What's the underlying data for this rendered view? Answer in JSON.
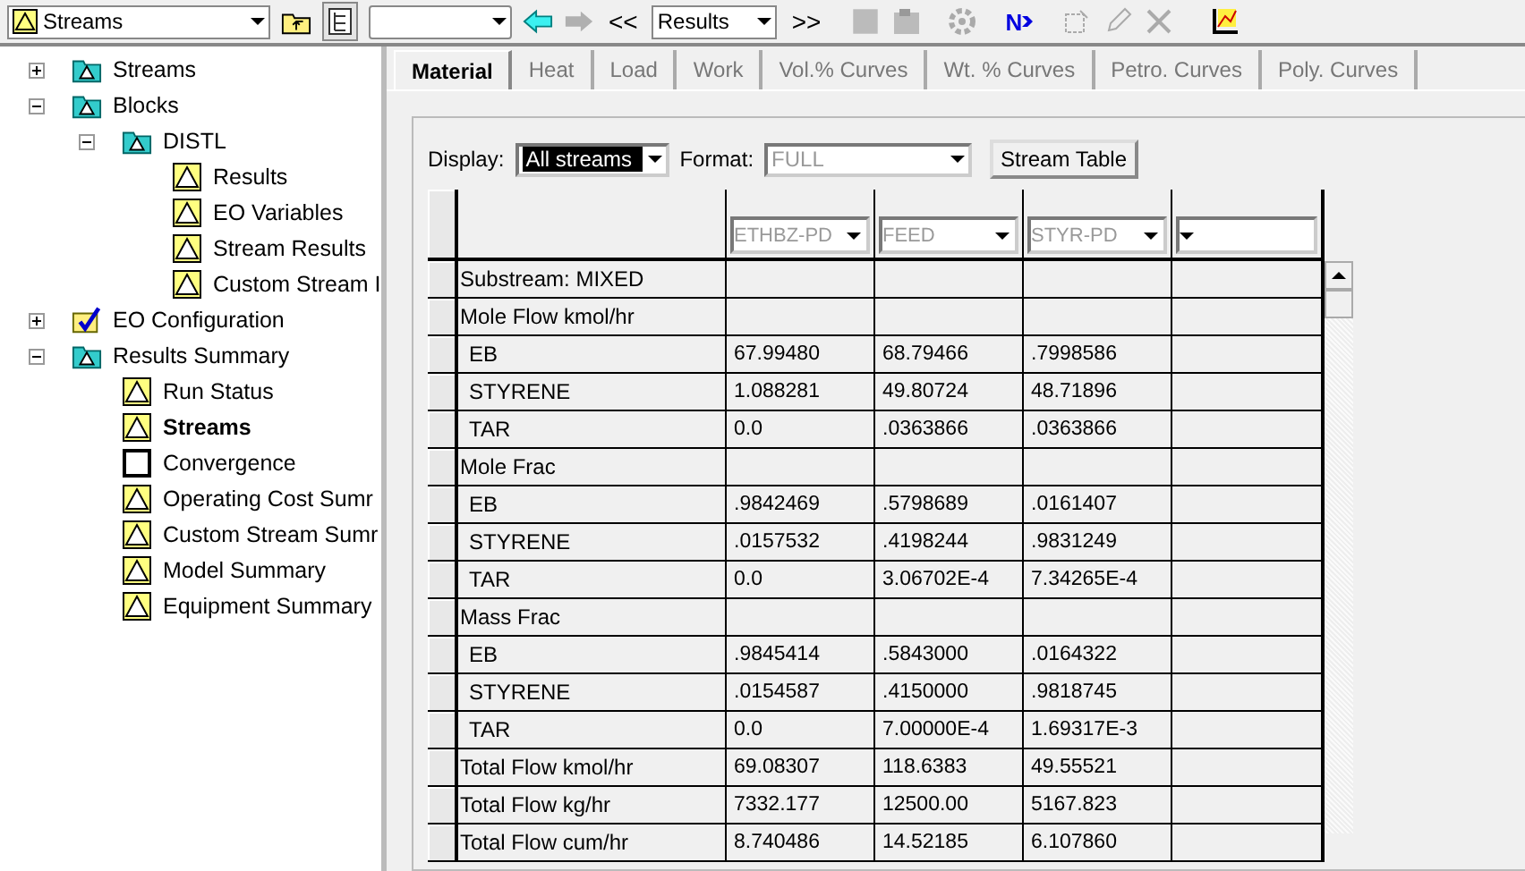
{
  "toolbar": {
    "object_combo": "Streams",
    "back_enabled": true,
    "forward_enabled": false,
    "prev_label": "<<",
    "results_combo": "Results",
    "next_label": ">>",
    "next_input_label": "N"
  },
  "tree": [
    {
      "label": "Streams",
      "kind": "folder",
      "expanded": false
    },
    {
      "label": "Blocks",
      "kind": "folder",
      "expanded": true,
      "children": [
        {
          "label": "DISTL",
          "kind": "folder",
          "expanded": true,
          "children": [
            {
              "label": "Results",
              "kind": "result"
            },
            {
              "label": "EO Variables",
              "kind": "result"
            },
            {
              "label": "Stream Results",
              "kind": "result"
            },
            {
              "label": "Custom Stream I",
              "kind": "result"
            }
          ]
        }
      ]
    },
    {
      "label": "EO Configuration",
      "kind": "configuration",
      "expanded": false
    },
    {
      "label": "Results Summary",
      "kind": "folder",
      "expanded": true,
      "children": [
        {
          "label": "Run Status",
          "kind": "result",
          "selected": false
        },
        {
          "label": "Streams",
          "kind": "result",
          "selected": true
        },
        {
          "label": "Convergence",
          "kind": "unavailable",
          "selected": false
        },
        {
          "label": "Operating Cost Sumr",
          "kind": "result",
          "selected": false
        },
        {
          "label": "Custom Stream Sumr",
          "kind": "result",
          "selected": false
        },
        {
          "label": "Model Summary",
          "kind": "result",
          "selected": false
        },
        {
          "label": "Equipment Summary",
          "kind": "result",
          "selected": false
        }
      ]
    }
  ],
  "tabs": [
    {
      "label": "Material",
      "selected": true
    },
    {
      "label": "Heat",
      "selected": false
    },
    {
      "label": "Load",
      "selected": false
    },
    {
      "label": "Work",
      "selected": false
    },
    {
      "label": "Vol.% Curves",
      "selected": false
    },
    {
      "label": "Wt. % Curves",
      "selected": false
    },
    {
      "label": "Petro. Curves",
      "selected": false
    },
    {
      "label": "Poly. Curves",
      "selected": false
    }
  ],
  "display": {
    "label": "Display:",
    "value": "All streams"
  },
  "format": {
    "label": "Format:",
    "value": "FULL"
  },
  "stream_table_button": "Stream Table",
  "columns": [
    {
      "value": "ETHBZ-PD"
    },
    {
      "value": "FEED"
    },
    {
      "value": "STYR-PD"
    },
    {}
  ],
  "rows": [
    {
      "kind": "section",
      "label": "Substream: MIXED"
    },
    {
      "kind": "section",
      "label": "Mole Flow kmol/hr"
    },
    {
      "kind": "component",
      "label": "EB",
      "values": [
        "67.99480",
        "68.79466",
        ".7998586"
      ]
    },
    {
      "kind": "component",
      "label": "STYRENE",
      "values": [
        "1.088281",
        "49.80724",
        "48.71896"
      ]
    },
    {
      "kind": "component",
      "label": "TAR",
      "values": [
        "0.0",
        ".0363866",
        ".0363866"
      ]
    },
    {
      "kind": "section",
      "label": "Mole Frac"
    },
    {
      "kind": "component",
      "label": "EB",
      "values": [
        ".9842469",
        ".5798689",
        ".0161407"
      ]
    },
    {
      "kind": "component",
      "label": "STYRENE",
      "values": [
        ".0157532",
        ".4198244",
        ".9831249"
      ]
    },
    {
      "kind": "component",
      "label": "TAR",
      "values": [
        "0.0",
        "3.06702E-4",
        "7.34265E-4"
      ]
    },
    {
      "kind": "section",
      "label": "Mass Frac"
    },
    {
      "kind": "component",
      "label": "EB",
      "values": [
        ".9845414",
        ".5843000",
        ".0164322"
      ]
    },
    {
      "kind": "component",
      "label": "STYRENE",
      "values": [
        ".0154587",
        ".4150000",
        ".9818745"
      ]
    },
    {
      "kind": "component",
      "label": "TAR",
      "values": [
        "0.0",
        "7.00000E-4",
        "1.69317E-3"
      ]
    },
    {
      "kind": "total",
      "label": "Total Flow kmol/hr",
      "values": [
        "69.08307",
        "118.6383",
        "49.55521"
      ]
    },
    {
      "kind": "total",
      "label": "Total Flow kg/hr",
      "values": [
        "7332.177",
        "12500.00",
        "5167.823"
      ]
    },
    {
      "kind": "total",
      "label": "Total Flow cum/hr",
      "values": [
        "8.740486",
        "14.52185",
        "6.107860"
      ]
    }
  ]
}
